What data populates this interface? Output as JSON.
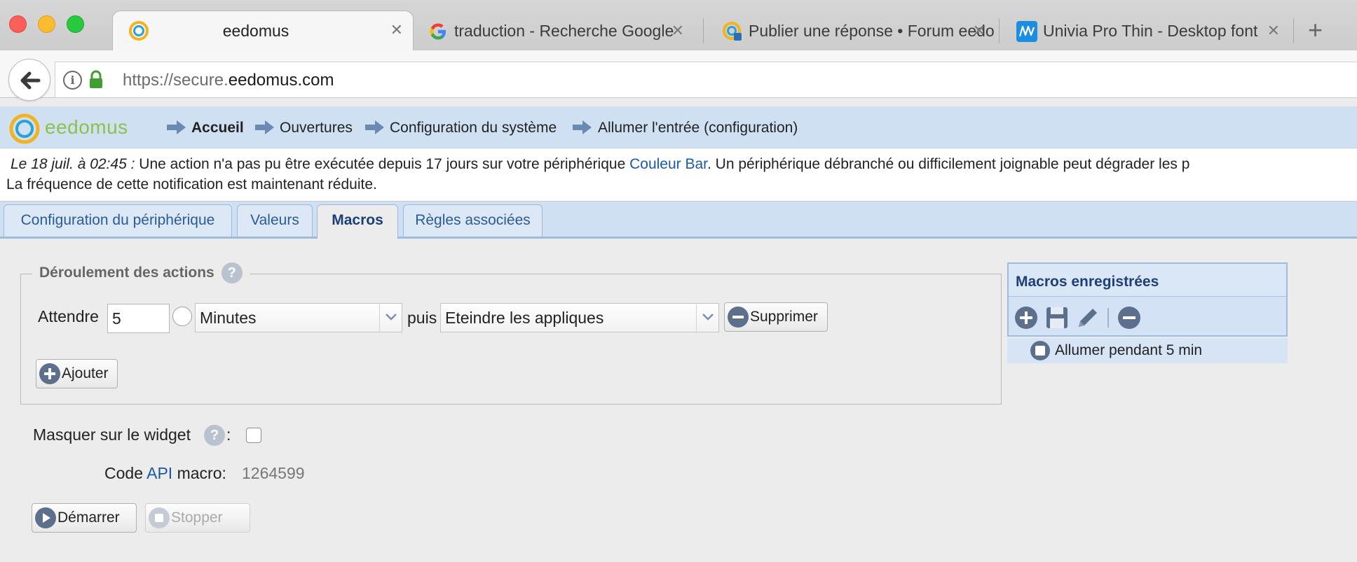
{
  "browser": {
    "tabs": [
      {
        "title": "eedomus",
        "active": true
      },
      {
        "title": "traduction - Recherche Google"
      },
      {
        "title": "Publier une réponse • Forum eedomus"
      },
      {
        "title": "Univia Pro Thin - Desktop font"
      }
    ],
    "url_prefix": "https://secure.",
    "url_domain": "eedomus.com"
  },
  "app": {
    "logo": "eedomus",
    "breadcrumb": [
      "Accueil",
      "Ouvertures",
      "Configuration du système",
      "Allumer l'entrée (configuration)"
    ]
  },
  "notice": {
    "date": "Le 18 juil. à 02:45 :",
    "text_before": " Une action n'a pas pu être exécutée depuis 17 jours sur votre périphérique ",
    "device_link": "Couleur Bar",
    "text_after": ". Un périphérique débranché ou difficilement joignable peut dégrader les p",
    "line2": "La fréquence de cette notification est maintenant réduite."
  },
  "page_tabs": [
    {
      "label": "Configuration du périphérique"
    },
    {
      "label": "Valeurs"
    },
    {
      "label": "Macros",
      "active": true
    },
    {
      "label": "Règles associées"
    }
  ],
  "actions": {
    "legend": "Déroulement des actions",
    "wait_label": "Attendre",
    "wait_value": "5",
    "unit": "Minutes",
    "then_label": "puis",
    "action": "Eteindre les appliques",
    "delete_label": "Supprimer",
    "add_label": "Ajouter"
  },
  "widget": {
    "hide_label": "Masquer sur le widget",
    "colon": ":",
    "hide_checked": false
  },
  "api": {
    "label_prefix": "Code ",
    "label_link": "API",
    "label_suffix": " macro:",
    "value": "1264599"
  },
  "controls": {
    "start_label": "Démarrer",
    "stop_label": "Stopper"
  },
  "macros_panel": {
    "title": "Macros enregistrées",
    "items": [
      "Allumer pendant 5 min"
    ]
  },
  "colors": {
    "header_bg": "#cfe0f3",
    "link": "#1b5aa8",
    "logo_green": "#8bc34a",
    "icon_circle": "#5c6f8c"
  }
}
